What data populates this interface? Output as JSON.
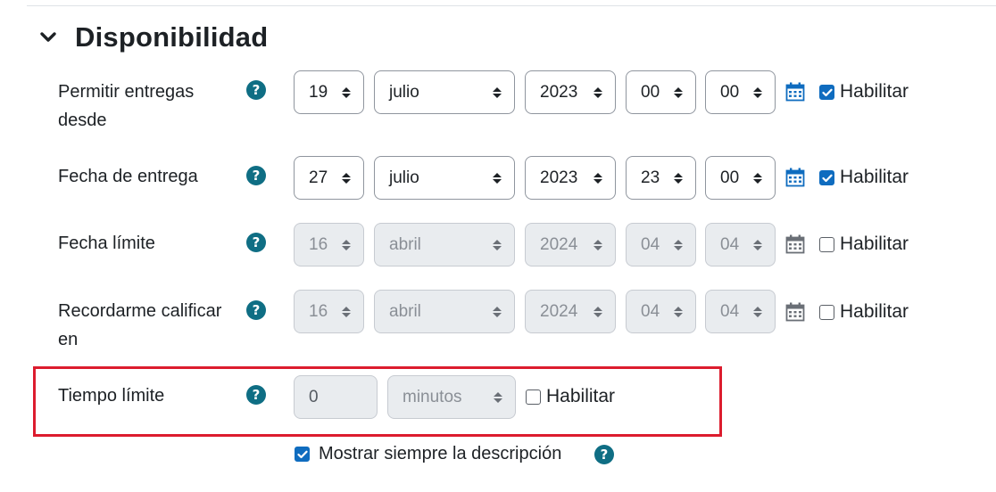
{
  "section": {
    "title": "Disponibilidad"
  },
  "rows": {
    "permitir": {
      "label": "Permitir entregas desde",
      "day": "19",
      "month": "julio",
      "year": "2023",
      "hour": "00",
      "minute": "00",
      "enable_label": "Habilitar",
      "enabled": true
    },
    "entrega": {
      "label": "Fecha de entrega",
      "day": "27",
      "month": "julio",
      "year": "2023",
      "hour": "23",
      "minute": "00",
      "enable_label": "Habilitar",
      "enabled": true
    },
    "limite": {
      "label": "Fecha límite",
      "day": "16",
      "month": "abril",
      "year": "2024",
      "hour": "04",
      "minute": "04",
      "enable_label": "Habilitar",
      "enabled": false
    },
    "recordar": {
      "label": "Recordarme calificar en",
      "day": "16",
      "month": "abril",
      "year": "2024",
      "hour": "04",
      "minute": "04",
      "enable_label": "Habilitar",
      "enabled": false
    }
  },
  "tiempo": {
    "label": "Tiempo límite",
    "value": "0",
    "unit": "minutos",
    "enable_label": "Habilitar",
    "enabled": false
  },
  "mostrar": {
    "label": "Mostrar siempre la descripción",
    "checked": true
  },
  "help_glyph": "?",
  "colors": {
    "accent": "#0f6cbf",
    "help": "#0f6e84",
    "highlight": "#dc1c2e",
    "disabled_bg": "#e9ecef"
  }
}
